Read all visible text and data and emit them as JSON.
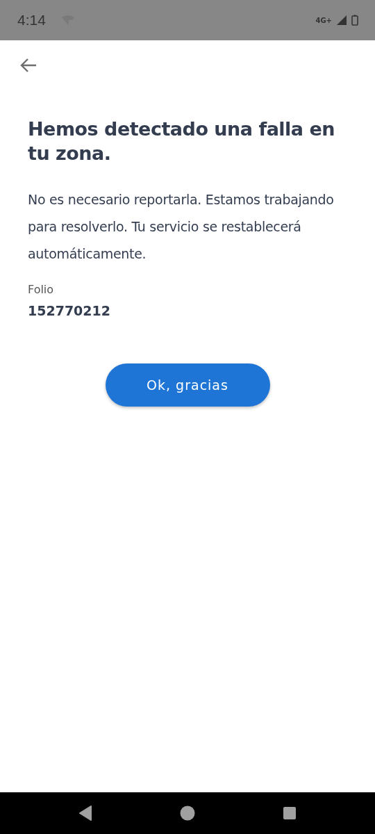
{
  "status_bar": {
    "time": "4:14",
    "network": "4G+"
  },
  "title": "Hemos detectado una falla en tu zona.",
  "message": "No es necesario reportarla. Estamos trabajando para resolverlo. Tu servicio se restablecerá automáticamente.",
  "folio": {
    "label": "Folio",
    "value": "152770212"
  },
  "button": "Ok, gracias"
}
